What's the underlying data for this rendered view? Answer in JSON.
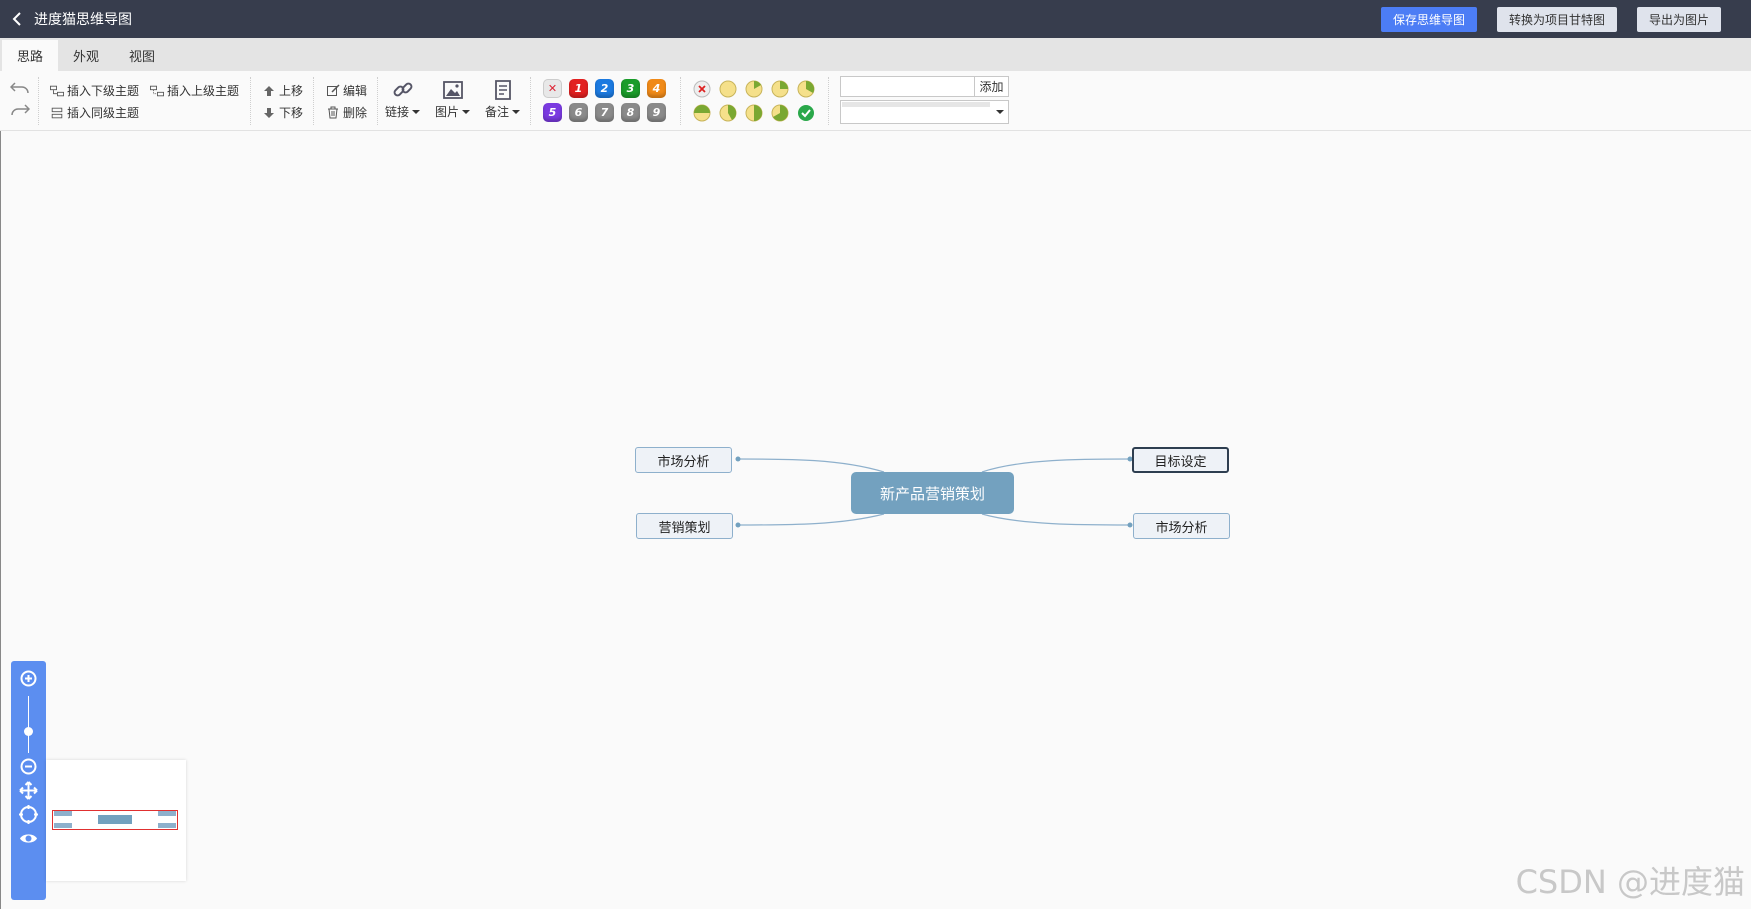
{
  "header": {
    "title": "进度猫思维导图",
    "actions": [
      "保存思维导图",
      "转换为项目甘特图",
      "导出为图片"
    ]
  },
  "tabs": [
    "思路",
    "外观",
    "视图"
  ],
  "toolbar": {
    "insert_child": "插入下级主题",
    "insert_parent": "插入上级主题",
    "insert_sibling": "插入同级主题",
    "move_up": "上移",
    "move_down": "下移",
    "edit": "编辑",
    "delete": "删除",
    "link": "链接",
    "image": "图片",
    "note": "备注",
    "priority_labels": [
      "✕",
      "1",
      "2",
      "3",
      "4",
      "5",
      "6",
      "7",
      "8",
      "9"
    ],
    "resource_add": "添加"
  },
  "mindmap": {
    "root": "新产品营销策划",
    "left_top": "市场分析",
    "left_bottom": "营销策划",
    "right_top": "目标设定",
    "right_bottom": "市场分析"
  },
  "colors": {
    "header_bg": "#373d4d",
    "accent": "#4c7df5",
    "root_node": "#73a1bf",
    "zoom_panel": "#5c8ef0"
  },
  "watermark": "CSDN @进度猫"
}
